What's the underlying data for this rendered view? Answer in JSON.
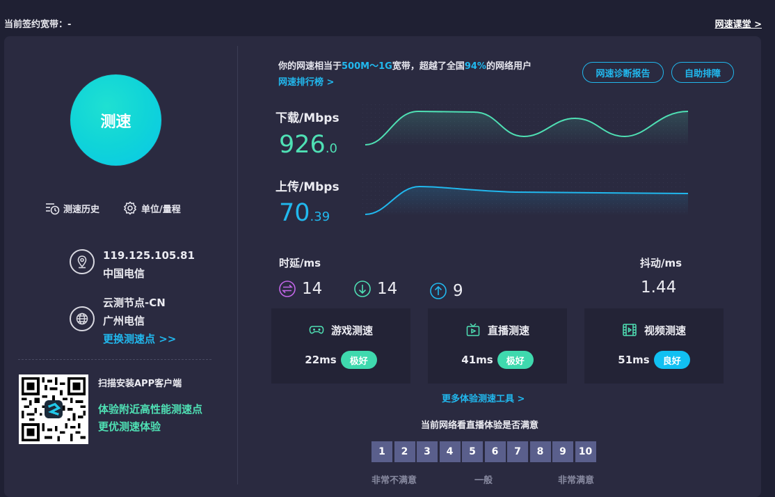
{
  "header": {
    "contract_label": "当前签约宽带：-",
    "classroom_link": "网速课堂 >"
  },
  "left": {
    "start_button": "测速",
    "history_link": "测速历史",
    "unit_link": "单位/量程",
    "ip": "119.125.105.81",
    "isp": "中国电信",
    "node_name": "云测节点-CN",
    "node_isp": "广州电信",
    "change_node_link": "更换测速点 >>",
    "qr_title": "扫描安装APP客户端",
    "qr_line1": "体验附近高性能测速点",
    "qr_line2": "更优测速体验"
  },
  "summary": {
    "prefix": "你的网速相当于",
    "bandwidth": "500M～1G",
    "middle": "宽带，超越了全国",
    "percent": "94%",
    "suffix": "的网络用户",
    "rank_link": "网速排行榜 >"
  },
  "buttons": {
    "diagnose": "网速诊断报告",
    "self_fix": "自助排障"
  },
  "download": {
    "label": "下载/Mbps",
    "int_part": "926",
    "dec_part": ".0"
  },
  "upload": {
    "label": "上传/Mbps",
    "int_part": "70",
    "dec_part": ".39"
  },
  "latency": {
    "label": "时延/ms",
    "total": "14",
    "down": "14",
    "up": "9"
  },
  "jitter": {
    "label": "抖动/ms",
    "value": "1.44"
  },
  "cards": [
    {
      "title": "游戏测速",
      "value": "22ms",
      "badge": "极好",
      "badge_color": "#3fd9ae"
    },
    {
      "title": "直播测速",
      "value": "41ms",
      "badge": "极好",
      "badge_color": "#3fd9ae"
    },
    {
      "title": "视频测速",
      "value": "51ms",
      "badge": "良好",
      "badge_color": "#11c0f2"
    }
  ],
  "more_tools_link": "更多体验测速工具 >",
  "rating": {
    "question": "当前网络看直播体验是否满意",
    "scale": [
      "1",
      "2",
      "3",
      "4",
      "5",
      "6",
      "7",
      "8",
      "9",
      "10"
    ],
    "low_label": "非常不满意",
    "mid_label": "一般",
    "high_label": "非常满意"
  },
  "colors": {
    "accent_blue": "#21b8ee",
    "accent_green": "#4fe0b4",
    "panel_bg": "#2a2a40",
    "page_bg": "#1f2033"
  }
}
